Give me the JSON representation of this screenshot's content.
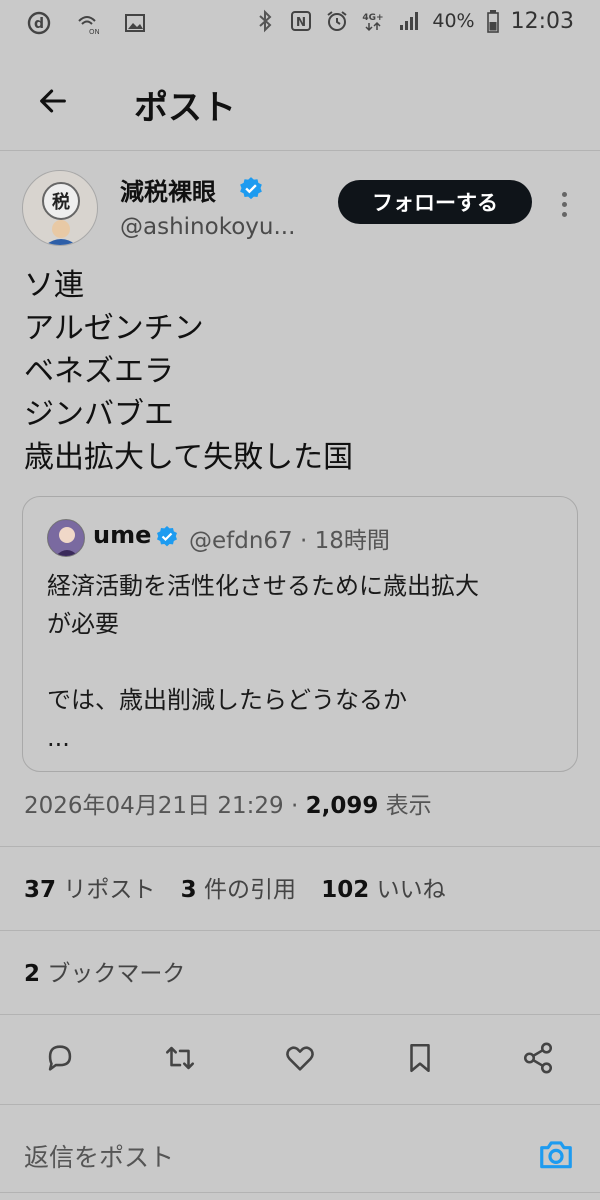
{
  "status_bar": {
    "battery": "40%",
    "time": "12:03",
    "network": "4G+",
    "wifi_label": "ON",
    "left_icons": [
      "docomo-d-icon",
      "wifi-calling-icon",
      "image-icon"
    ],
    "right_icons": [
      "bluetooth-icon",
      "nfc-icon",
      "alarm-icon",
      "network-4g-icon",
      "signal-icon",
      "battery-icon"
    ]
  },
  "header": {
    "title": "ポスト",
    "back_icon": "arrow-left-icon"
  },
  "post": {
    "author": {
      "name": "減税裸眼",
      "handle": "@ashinokoyu...",
      "verified": true,
      "avatar_badge": "税"
    },
    "follow_label": "フォローする",
    "body_lines": [
      "ソ連",
      "アルゼンチン",
      "ベネズエラ",
      "ジンバブエ",
      "歳出拡大して失敗した国"
    ],
    "quote": {
      "name": "ume",
      "handle_time": "@efdn67 · 18時間",
      "verified": true,
      "lines": [
        "経済活動を活性化させるために歳出拡大",
        "が必要",
        "",
        "では、歳出削減したらどうなるか",
        "..."
      ]
    },
    "meta": {
      "datetime": "2026年04月21日 21:29 · ",
      "views_count": "2,099",
      "views_label": " 表示"
    },
    "stats": {
      "reposts_count": "37",
      "reposts_label": " リポスト",
      "quotes_count": "3",
      "quotes_label": " 件の引用",
      "likes_count": "102",
      "likes_label": " いいね"
    },
    "bookmarks": {
      "count": "2",
      "label": " ブックマーク"
    }
  },
  "actions": [
    "reply-icon",
    "repost-icon",
    "like-icon",
    "bookmark-icon",
    "share-icon"
  ],
  "reply_bar": {
    "placeholder": "返信をポスト",
    "camera_icon": "camera-icon"
  },
  "colors": {
    "background": "#c9c9c9",
    "verified": "#1d9bf0",
    "follow_button": "#0f1419",
    "camera": "#1d9bf0"
  }
}
